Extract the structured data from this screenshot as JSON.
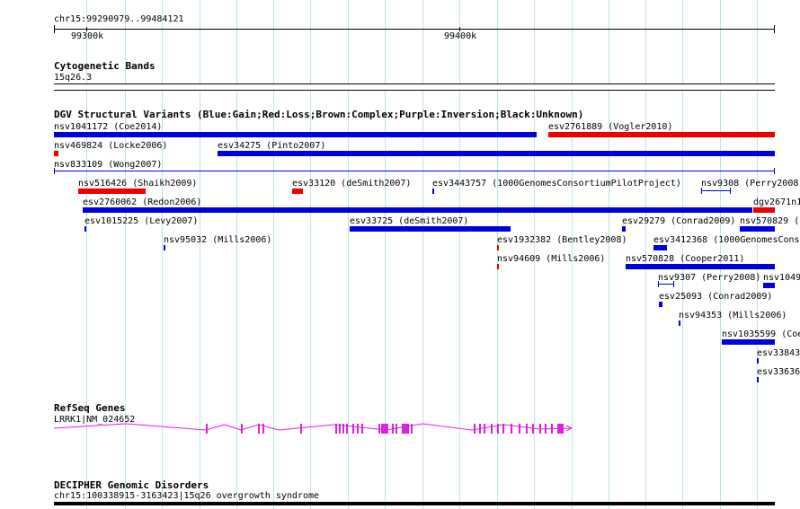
{
  "region": {
    "label": "chr15:99290979..99484121"
  },
  "ruler": {
    "ticks": [
      "99300k",
      "99400k"
    ]
  },
  "tracks": {
    "cytoband": {
      "title": "Cytogenetic Bands",
      "band": "15q26.3"
    },
    "dgv": {
      "title": "DGV Structural Variants (Blue:Gain;Red:Loss;Brown:Complex;Purple:Inversion;Black:Unknown)"
    },
    "refseq": {
      "title": "RefSeq Genes",
      "gene": "LRRK1|NM_024652"
    },
    "decipher": {
      "title": "DECIPHER Genomic Disorders",
      "item": "chr15:100338915-3163423|15q26 overgrowth syndrome"
    }
  },
  "colors": {
    "gain": "#0000dd",
    "loss": "#ee0000",
    "gene": "#dd22dd",
    "grid": "#bde3ee"
  },
  "variants": [
    {
      "id": "nsv1041172 (Coe2014)",
      "type": "gain"
    },
    {
      "id": "esv2761889 (Vogler2010)",
      "type": "loss"
    },
    {
      "id": "nsv469824 (Locke2006)",
      "type": "loss"
    },
    {
      "id": "esv34275 (Pinto2007)",
      "type": "gain"
    },
    {
      "id": "nsv833109 (Wong2007)",
      "type": "gain"
    },
    {
      "id": "nsv516426 (Shaikh2009)",
      "type": "loss"
    },
    {
      "id": "esv33120 (deSmith2007)",
      "type": "loss"
    },
    {
      "id": "esv3443757 (1000GenomesConsortiumPilotProject)",
      "type": "gain"
    },
    {
      "id": "nsv9308 (Perry2008)",
      "type": "gain"
    },
    {
      "id": "esv2760062 (Redon2006)",
      "type": "gain"
    },
    {
      "id": "dgv2671n1",
      "type": "loss"
    },
    {
      "id": "esv1015225 (Levy2007)",
      "type": "gain"
    },
    {
      "id": "esv33725 (deSmith2007)",
      "type": "gain"
    },
    {
      "id": "esv29279 (Conrad2009)",
      "type": "gain"
    },
    {
      "id": "nsv570829 (C",
      "type": "gain"
    },
    {
      "id": "nsv95032 (Mills2006)",
      "type": "gain"
    },
    {
      "id": "esv1932382 (Bentley2008)",
      "type": "loss"
    },
    {
      "id": "esv3412368 (1000GenomesConso",
      "type": "gain"
    },
    {
      "id": "nsv94609 (Mills2006)",
      "type": "loss"
    },
    {
      "id": "nsv570828 (Cooper2011)",
      "type": "gain"
    },
    {
      "id": "nsv9307 (Perry2008)",
      "type": "gain"
    },
    {
      "id": "nsv1049",
      "type": "gain"
    },
    {
      "id": "esv25093 (Conrad2009)",
      "type": "gain"
    },
    {
      "id": "nsv94353 (Mills2006)",
      "type": "gain"
    },
    {
      "id": "nsv1035599 (Coe",
      "type": "gain"
    },
    {
      "id": "esv33843",
      "type": "gain"
    },
    {
      "id": "esv33636",
      "type": "gain"
    }
  ]
}
